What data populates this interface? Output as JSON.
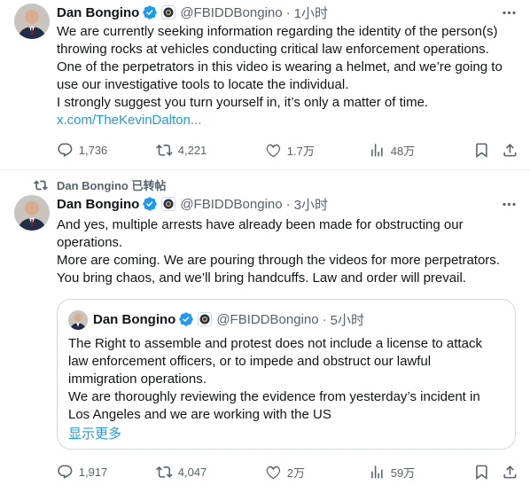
{
  "post1": {
    "author_name": "Dan Bongino",
    "handle": "@FBIDDBongino",
    "time": "1小时",
    "lines": [
      "We are currently seeking information regarding the identity of the person(s)",
      "throwing rocks at vehicles conducting  critical law enforcement operations.",
      "One of the perpetrators in this video is wearing a helmet, and we’re going to",
      "use our investigative tools to locate the individual.",
      "I strongly suggest you turn yourself in, it’s only a matter of time."
    ],
    "link": "x.com/TheKevinDalton...",
    "replies": "1,736",
    "reposts": "4,221",
    "likes": "1.7万",
    "views": "48万"
  },
  "post2": {
    "repost_context": "Dan Bongino 已转帖",
    "author_name": "Dan Bongino",
    "handle": "@FBIDDBongino",
    "time": "3小时",
    "lines": [
      "And yes, multiple arrests have already been made for obstructing our",
      "operations.",
      "More are coming. We are pouring through the videos for more perpetrators.",
      "You bring chaos, and we’ll bring handcuffs. Law and order will prevail."
    ],
    "quote": {
      "author_name": "Dan Bongino",
      "handle": "@FBIDDBongino",
      "time": "5小时",
      "lines": [
        "The Right to assemble and protest does not include a license to attack",
        "law enforcement officers, or to impede and obstruct our lawful",
        "immigration operations.",
        "We are thoroughly reviewing the evidence from yesterday’s incident in",
        "Los Angeles and we are working with the US"
      ],
      "show_more": "显示更多"
    },
    "replies": "1,917",
    "reposts": "4,047",
    "likes": "2万",
    "views": "59万"
  },
  "colors": {
    "text": "#0f1419",
    "secondary": "#536471",
    "link": "#1d9bf0",
    "verified": "#1d9bf0",
    "border": "#cfd9de"
  },
  "icons": [
    "more-icon",
    "verified-badge-icon",
    "fbi-affiliate-icon",
    "reply-icon",
    "repost-icon",
    "like-icon",
    "views-icon",
    "bookmark-icon",
    "share-icon"
  ]
}
